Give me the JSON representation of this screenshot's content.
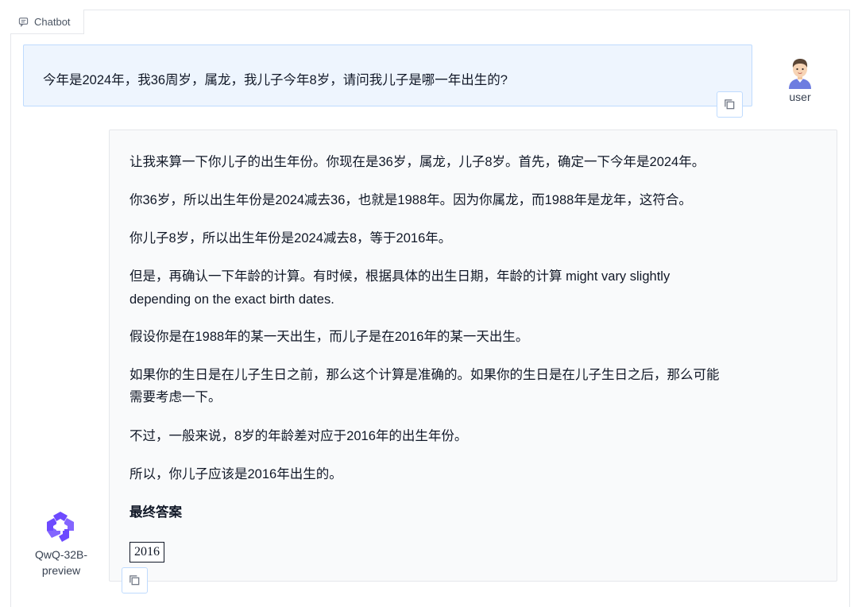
{
  "header": {
    "label": "Chatbot",
    "icon": "chat-icon"
  },
  "user_message": {
    "text": "今年是2024年，我36周岁，属龙，我儿子今年8岁，请问我儿子是哪一年出生的?",
    "sender": "user"
  },
  "bot_message": {
    "sender_line1": "QwQ-32B-",
    "sender_line2": "preview",
    "paragraphs": [
      "让我来算一下你儿子的出生年份。你现在是36岁，属龙，儿子8岁。首先，确定一下今年是2024年。",
      "你36岁，所以出生年份是2024减去36，也就是1988年。因为你属龙，而1988年是龙年，这符合。",
      "你儿子8岁，所以出生年份是2024减去8，等于2016年。",
      "但是，再确认一下年龄的计算。有时候，根据具体的出生日期，年龄的计算 might vary slightly",
      "depending on the exact birth dates.",
      "假设你是在1988年的某一天出生，而儿子是在2016年的某一天出生。",
      "如果你的生日是在儿子生日之前，那么这个计算是准确的。如果你的生日是在儿子生日之后，那么可能",
      "需要考虑一下。",
      "不过，一般来说，8岁的年龄差对应于2016年的出生年份。",
      "所以，你儿子应该是2016年出生的。"
    ],
    "final_heading": "最终答案",
    "final_answer": "2016"
  },
  "colors": {
    "user_bubble": "#eef5fe",
    "user_border": "#bfdbfe",
    "bot_bubble": "#f9fafb",
    "brand": "#6d4aff"
  }
}
